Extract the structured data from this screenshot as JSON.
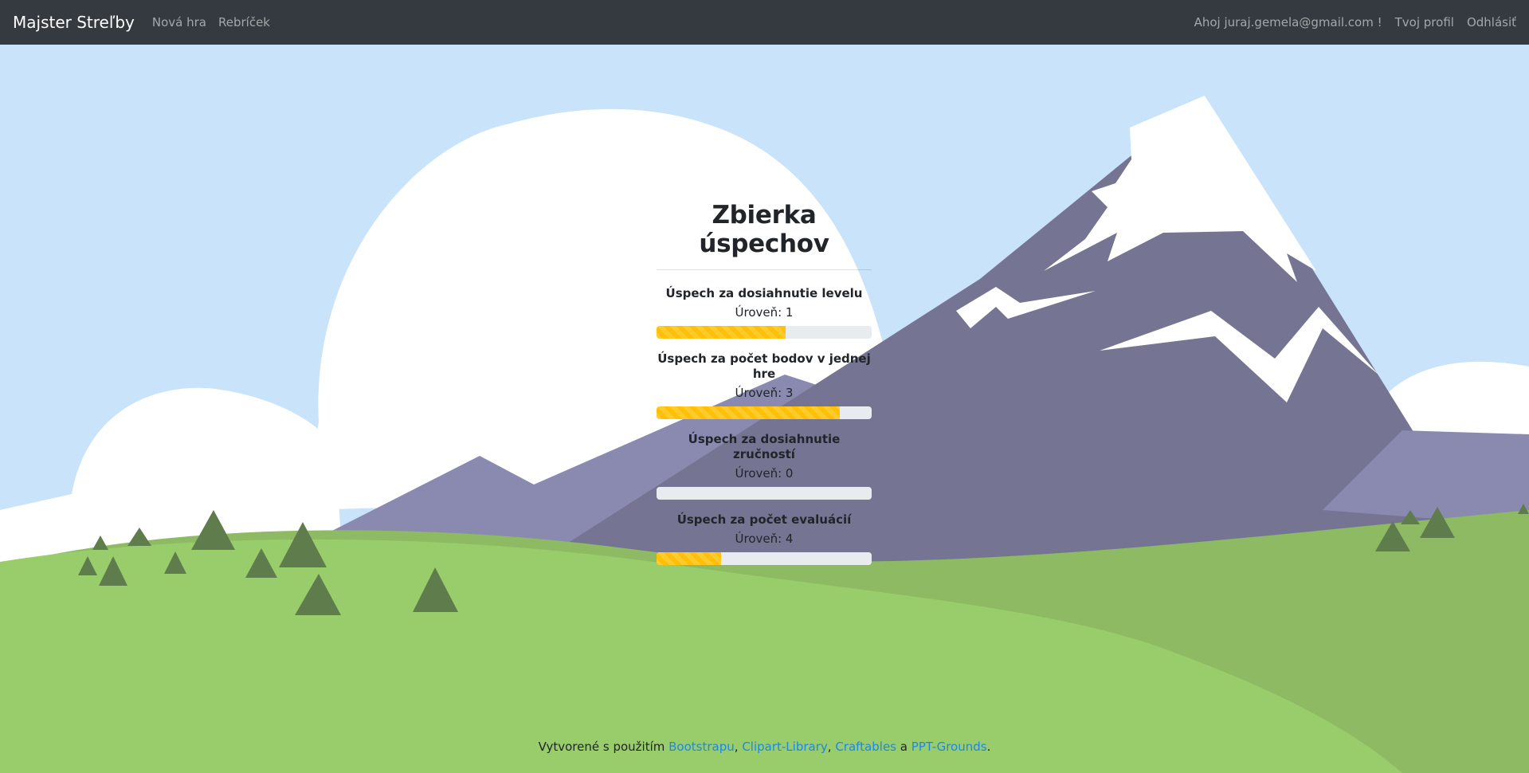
{
  "navbar": {
    "brand": "Majster Streľby",
    "links": [
      "Nová hra",
      "Rebríček"
    ],
    "greeting": "Ahoj juraj.gemela@gmail.com !",
    "profile": "Tvoj profil",
    "logout": "Odhlásiť"
  },
  "main": {
    "title": "Zbierka úspechov",
    "achievements": [
      {
        "title": "Úspech za dosiahnutie levelu",
        "level": "Úroveň: 1",
        "progress_pct": 60
      },
      {
        "title": "Úspech za počet bodov v jednej hre",
        "level": "Úroveň: 3",
        "progress_pct": 85
      },
      {
        "title": "Úspech za dosiahnutie zručností",
        "level": "Úroveň: 0",
        "progress_pct": 0
      },
      {
        "title": "Úspech za počet evaluácií",
        "level": "Úroveň: 4",
        "progress_pct": 30
      }
    ]
  },
  "footer": {
    "prefix": "Vytvorené s použitím",
    "links": [
      "Bootstrapu",
      "Clipart-Library",
      "Craftables",
      "PPT-Grounds"
    ],
    "sep": ",",
    "and": "a",
    "end": "."
  },
  "colors": {
    "navbar_bg": "#343a40",
    "sky": "#c9e3fb",
    "progress": "#ffc107",
    "link": "#1e88e5"
  }
}
